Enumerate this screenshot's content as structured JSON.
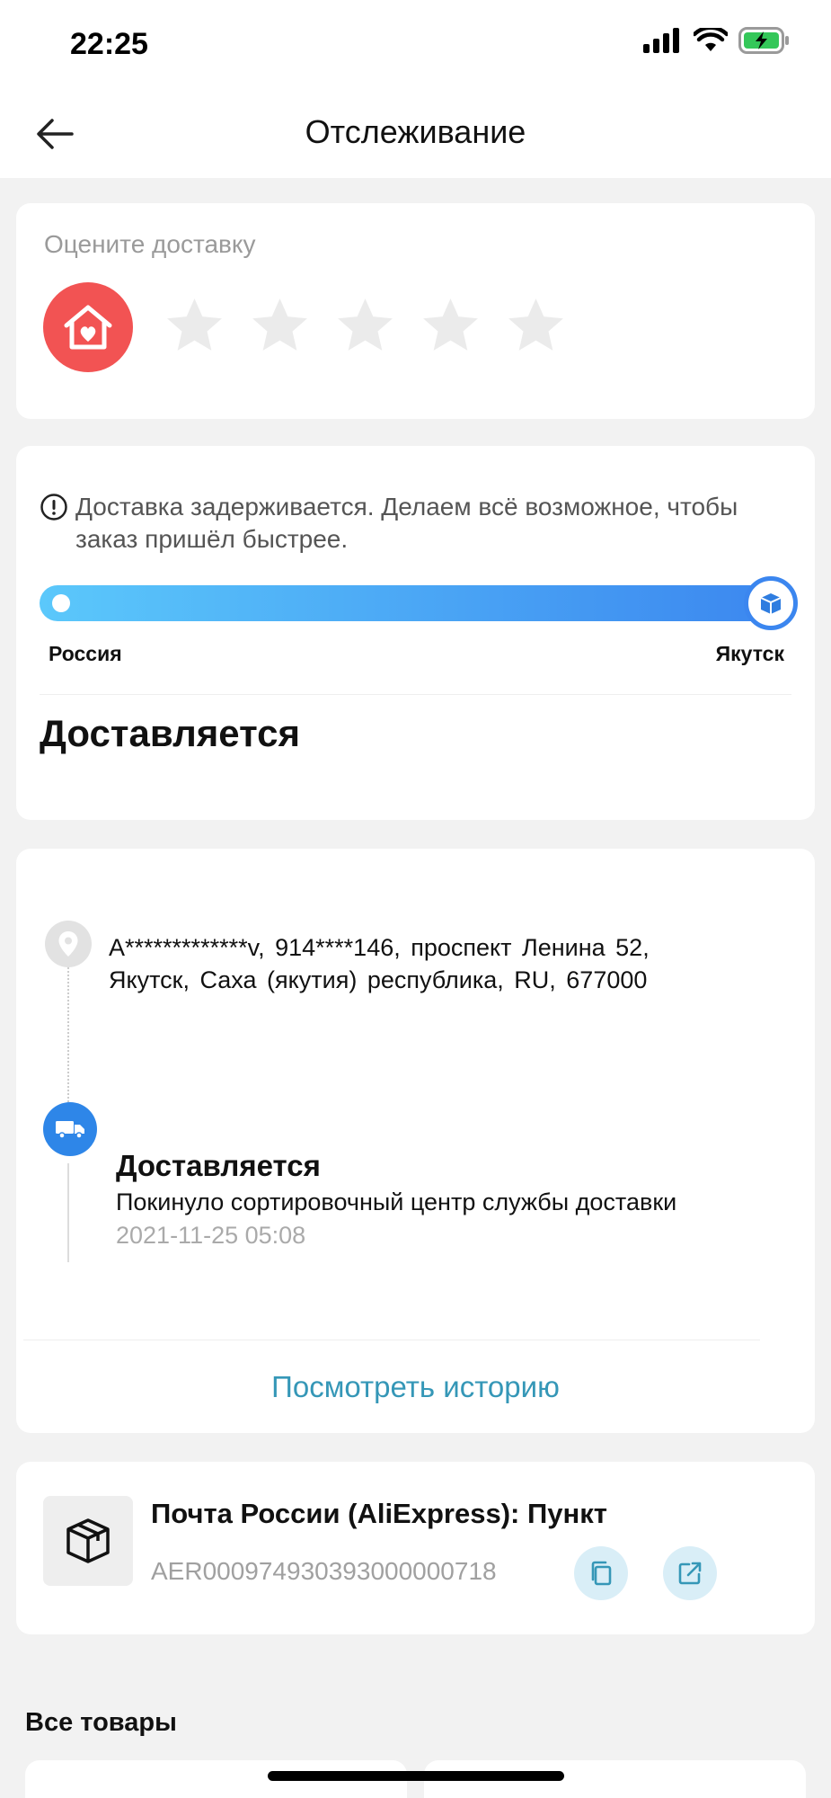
{
  "status_bar": {
    "time": "22:25"
  },
  "header": {
    "title": "Отслеживание",
    "back_icon": "arrow-left-icon"
  },
  "rating": {
    "label": "Оцените доставку",
    "stars_max": 5,
    "stars_selected": 0,
    "avatar_icon": "home-heart-icon"
  },
  "delivery_status": {
    "notice": "Доставка задерживается. Делаем всё возможное, чтобы заказ пришёл быстрее.",
    "from": "Россия",
    "to": "Якутск",
    "progress": 1.0,
    "status": "Доставляется"
  },
  "tracking": {
    "address": "A*************v,  914****146,  проспект Ленина 52,  Якутск,  Саха (якутия) республика,  RU,  677000",
    "event_title": "Доставляется",
    "event_desc": "Покинуло сортировочный центр службы доставки",
    "event_time": "2021-11-25 05:08",
    "history_link": "Посмотреть историю"
  },
  "carrier": {
    "name": "Почта России (AliExpress): Пункт",
    "tracking_number": "AER000974930393000000718",
    "copy_icon": "copy-icon",
    "open_icon": "external-link-icon"
  },
  "goods": {
    "title": "Все товары"
  },
  "colors": {
    "accent_blue": "#3b86ef",
    "link": "#3597b7",
    "avatar_red": "#f25353"
  }
}
